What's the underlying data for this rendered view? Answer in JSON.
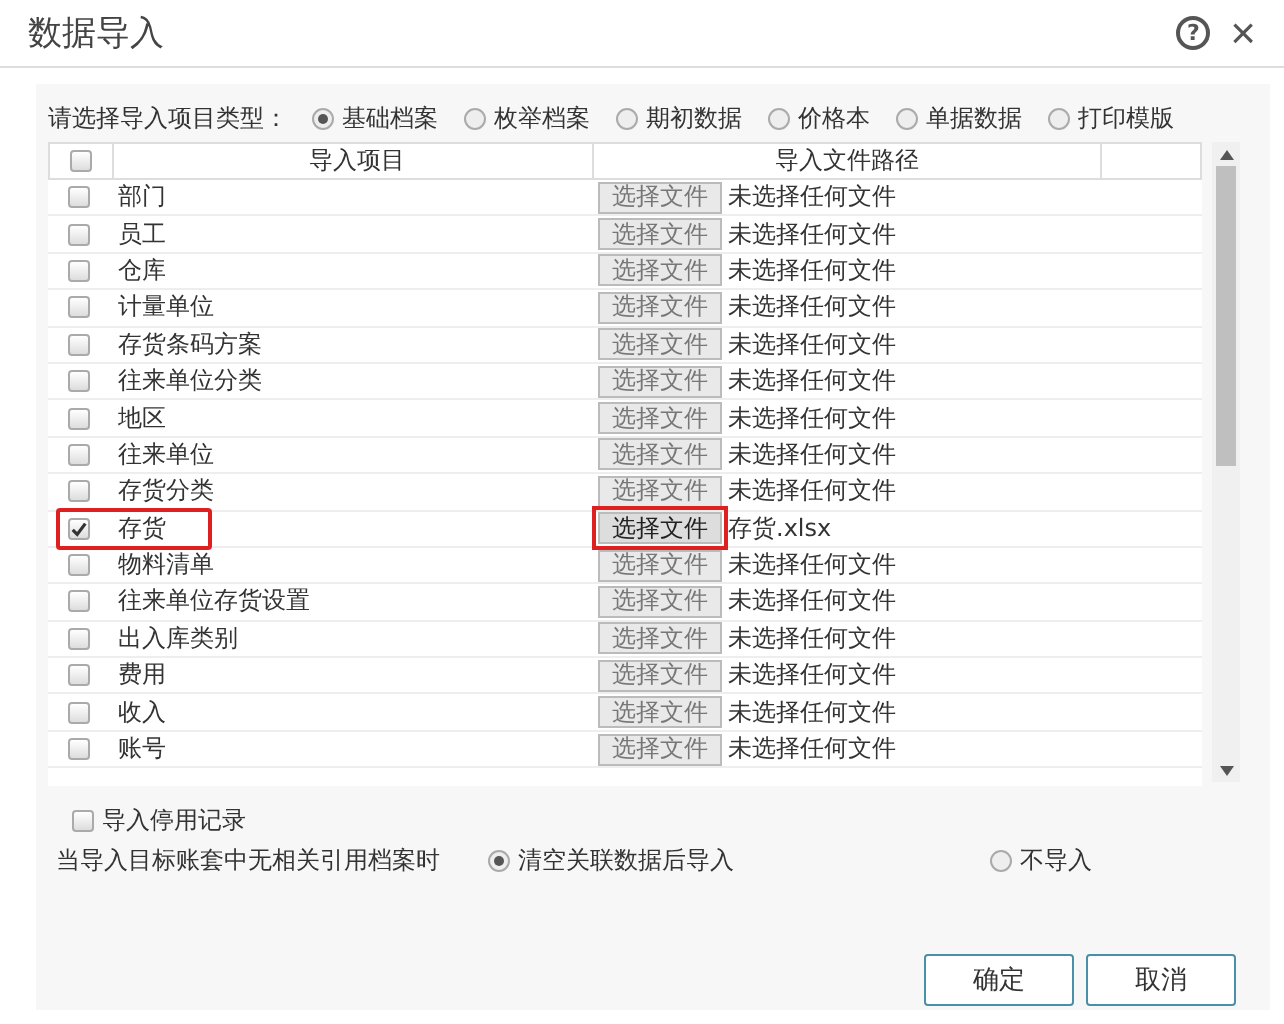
{
  "window": {
    "title": "数据导入",
    "help": "?",
    "close": "×"
  },
  "type_prompt": "请选择导入项目类型：",
  "types": [
    {
      "label": "基础档案",
      "selected": true
    },
    {
      "label": "枚举档案",
      "selected": false
    },
    {
      "label": "期初数据",
      "selected": false
    },
    {
      "label": "价格本",
      "selected": false
    },
    {
      "label": "单据数据",
      "selected": false
    },
    {
      "label": "打印模版",
      "selected": false
    }
  ],
  "table": {
    "all_checked": false,
    "columns": [
      "导入项目",
      "导入文件路径"
    ],
    "rows": [
      {
        "item": "部门",
        "checked": false,
        "button": "选择文件",
        "file": "未选择任何文件",
        "highlighted": false
      },
      {
        "item": "员工",
        "checked": false,
        "button": "选择文件",
        "file": "未选择任何文件",
        "highlighted": false
      },
      {
        "item": "仓库",
        "checked": false,
        "button": "选择文件",
        "file": "未选择任何文件",
        "highlighted": false
      },
      {
        "item": "计量单位",
        "checked": false,
        "button": "选择文件",
        "file": "未选择任何文件",
        "highlighted": false
      },
      {
        "item": "存货条码方案",
        "checked": false,
        "button": "选择文件",
        "file": "未选择任何文件",
        "highlighted": false
      },
      {
        "item": "往来单位分类",
        "checked": false,
        "button": "选择文件",
        "file": "未选择任何文件",
        "highlighted": false
      },
      {
        "item": "地区",
        "checked": false,
        "button": "选择文件",
        "file": "未选择任何文件",
        "highlighted": false
      },
      {
        "item": "往来单位",
        "checked": false,
        "button": "选择文件",
        "file": "未选择任何文件",
        "highlighted": false
      },
      {
        "item": "存货分类",
        "checked": false,
        "button": "选择文件",
        "file": "未选择任何文件",
        "highlighted": false
      },
      {
        "item": "存货",
        "checked": true,
        "button": "选择文件",
        "file": "存货.xlsx",
        "highlighted": true
      },
      {
        "item": "物料清单",
        "checked": false,
        "button": "选择文件",
        "file": "未选择任何文件",
        "highlighted": false
      },
      {
        "item": "往来单位存货设置",
        "checked": false,
        "button": "选择文件",
        "file": "未选择任何文件",
        "highlighted": false
      },
      {
        "item": "出入库类别",
        "checked": false,
        "button": "选择文件",
        "file": "未选择任何文件",
        "highlighted": false
      },
      {
        "item": "费用",
        "checked": false,
        "button": "选择文件",
        "file": "未选择任何文件",
        "highlighted": false
      },
      {
        "item": "收入",
        "checked": false,
        "button": "选择文件",
        "file": "未选择任何文件",
        "highlighted": false
      },
      {
        "item": "账号",
        "checked": false,
        "button": "选择文件",
        "file": "未选择任何文件",
        "highlighted": false
      }
    ]
  },
  "import_disabled": {
    "label": "导入停用记录",
    "checked": false
  },
  "missing_prompt": "当导入目标账套中无相关引用档案时",
  "missing_options": [
    {
      "label": "清空关联数据后导入",
      "selected": true
    },
    {
      "label": "不导入",
      "selected": false
    }
  ],
  "buttons": [
    "确定",
    "取消"
  ]
}
